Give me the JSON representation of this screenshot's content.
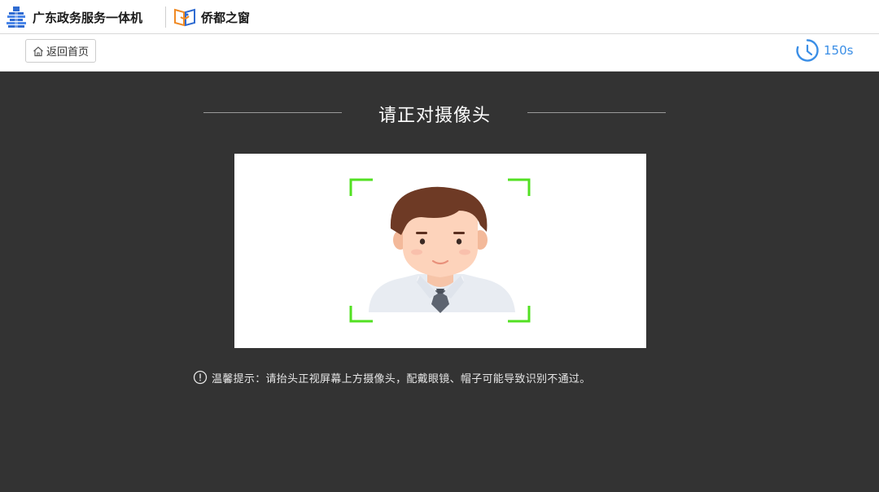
{
  "header": {
    "gov_brand": "广东政务服务一体机",
    "qd_brand": "侨都之窗"
  },
  "toolbar": {
    "home_label": "返回首页",
    "timer": "150s"
  },
  "main": {
    "title": "请正对摄像头",
    "tip": "温馨提示：请抬头正视屏幕上方摄像头，配戴眼镜、帽子可能导致识别不通过。"
  },
  "colors": {
    "accent": "#3a8ee6",
    "frame": "#52e022",
    "background": "#333333"
  }
}
